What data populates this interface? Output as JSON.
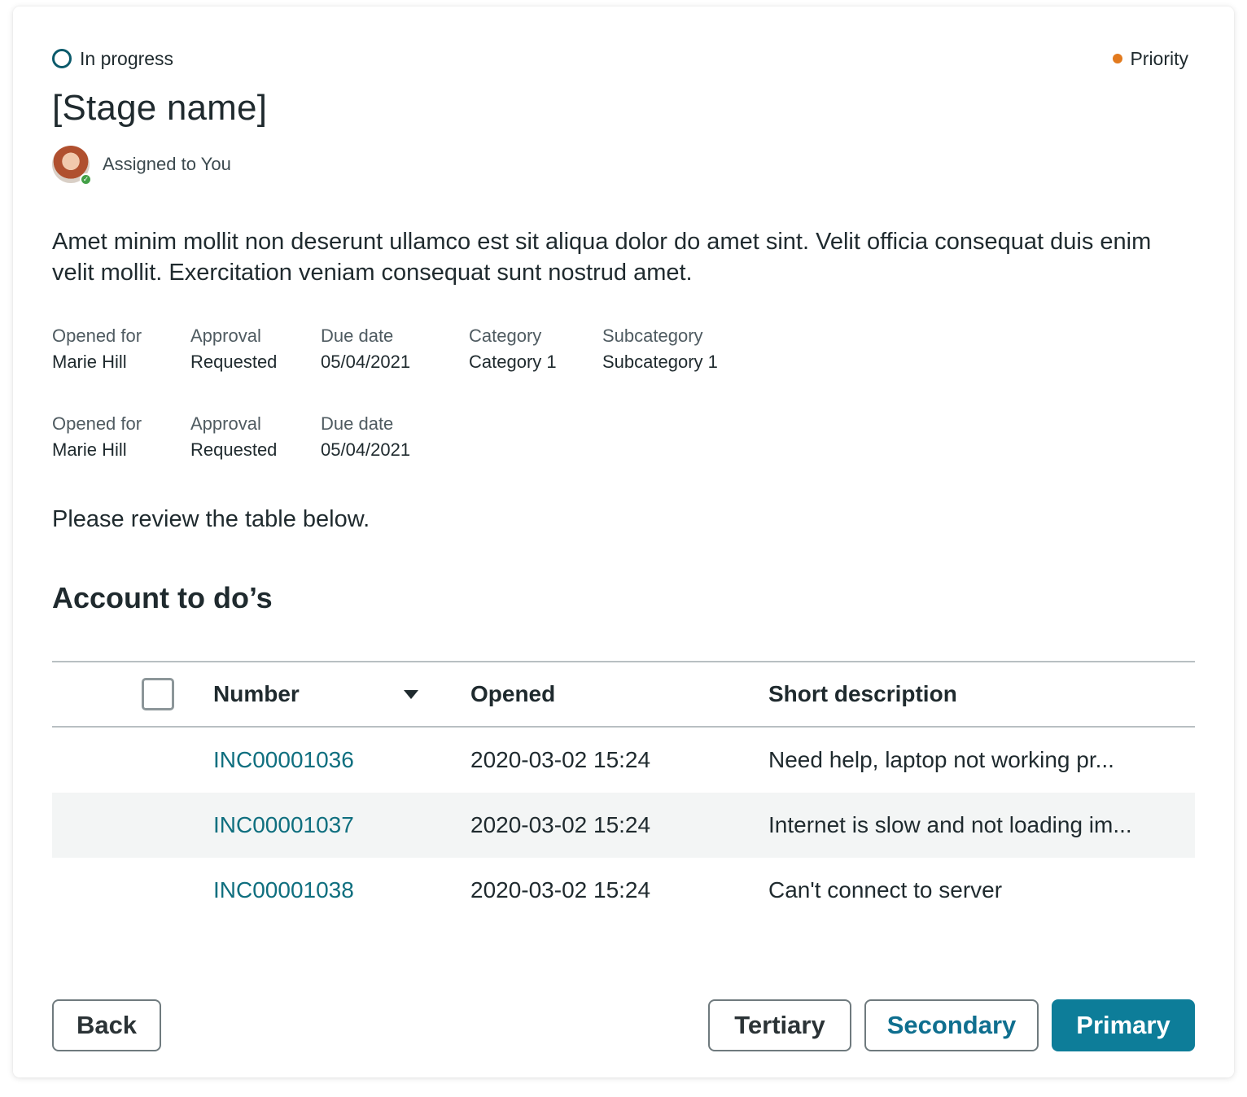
{
  "header": {
    "status_label": "In progress",
    "priority_label": "Priority",
    "title": "[Stage name]",
    "assignee_label": "Assigned to You"
  },
  "description": "Amet minim mollit non deserunt ullamco est sit aliqua dolor do amet sint. Velit officia consequat duis enim velit mollit. Exercitation veniam consequat sunt nostrud amet.",
  "fields_row1": [
    {
      "label": "Opened for",
      "value": "Marie Hill"
    },
    {
      "label": "Approval",
      "value": "Requested"
    },
    {
      "label": "Due date",
      "value": "05/04/2021"
    },
    {
      "label": "Category",
      "value": "Category 1"
    },
    {
      "label": "Subcategory",
      "value": "Subcategory 1"
    }
  ],
  "fields_row2": [
    {
      "label": "Opened for",
      "value": "Marie Hill"
    },
    {
      "label": "Approval",
      "value": "Requested"
    },
    {
      "label": "Due date",
      "value": "05/04/2021"
    }
  ],
  "note": "Please review the table below.",
  "section_title": "Account to do’s",
  "table": {
    "headers": {
      "number": "Number",
      "opened": "Opened",
      "short_description": "Short description"
    },
    "rows": [
      {
        "number": "INC00001036",
        "opened": "2020-03-02 15:24",
        "short_description": "Need help, laptop not working pr..."
      },
      {
        "number": "INC00001037",
        "opened": "2020-03-02 15:24",
        "short_description": "Internet is slow and not loading im..."
      },
      {
        "number": "INC00001038",
        "opened": "2020-03-02 15:24",
        "short_description": "Can't connect to server"
      }
    ]
  },
  "buttons": {
    "back": "Back",
    "tertiary": "Tertiary",
    "secondary": "Secondary",
    "primary": "Primary"
  },
  "colors": {
    "status_ring": "#0b5a6b",
    "priority_dot": "#e27a1e",
    "link": "#0f6f7f",
    "primary_button": "#0d7d99",
    "presence_online": "#43a047"
  }
}
